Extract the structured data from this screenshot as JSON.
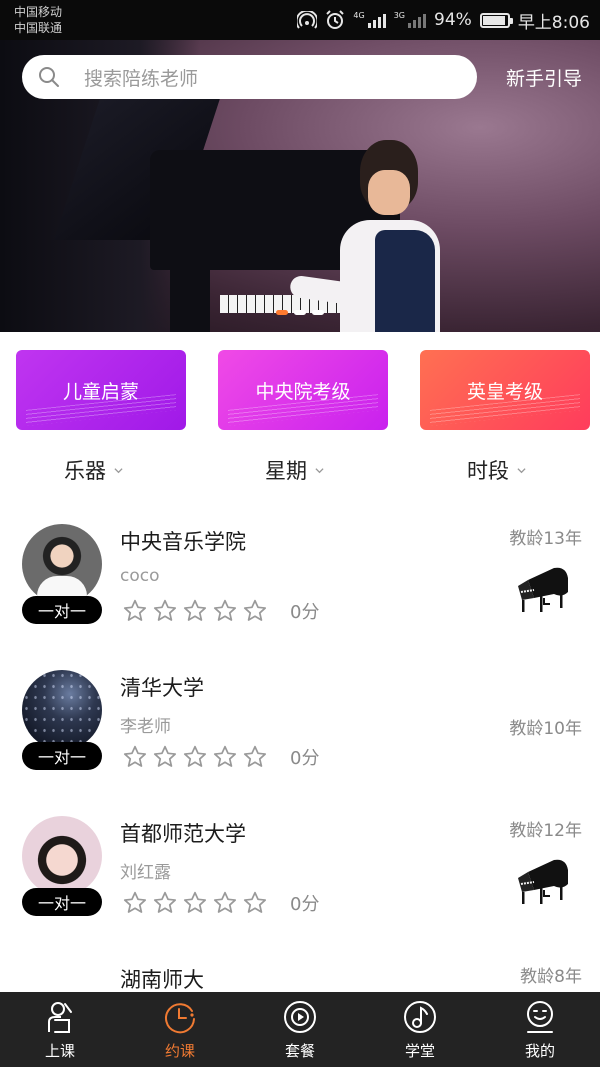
{
  "status_bar": {
    "carrier_1": "中国移动",
    "carrier_2": "中国联通",
    "net_1": "4G",
    "net_2": "3G",
    "battery": "94%",
    "battery_level": 0.94,
    "time": "早上8:06"
  },
  "search": {
    "placeholder": "搜索陪练老师",
    "guide_label": "新手引导"
  },
  "banner": {
    "slide_count": 3,
    "active_slide": 0
  },
  "categories": [
    {
      "label": "儿童启蒙"
    },
    {
      "label": "中央院考级"
    },
    {
      "label": "英皇考级"
    }
  ],
  "filters": [
    {
      "label": "乐器"
    },
    {
      "label": "星期"
    },
    {
      "label": "时段"
    }
  ],
  "teachers": [
    {
      "school": "中央音乐学院",
      "name": "coco",
      "badge": "一对一",
      "stars": 0,
      "score": "0分",
      "experience": "教龄13年",
      "piano_icon": true
    },
    {
      "school": "清华大学",
      "name": "李老师",
      "badge": "一对一",
      "stars": 0,
      "score": "0分",
      "experience": "教龄10年",
      "piano_icon": false
    },
    {
      "school": "首都师范大学",
      "name": "刘红露",
      "badge": "一对一",
      "stars": 0,
      "score": "0分",
      "experience": "教龄12年",
      "piano_icon": true
    },
    {
      "school": "湖南师大",
      "experience": "教龄8年"
    }
  ],
  "nav": [
    {
      "label": "上课",
      "icon": "lesson-icon"
    },
    {
      "label": "约课",
      "icon": "clock-icon",
      "active": true
    },
    {
      "label": "套餐",
      "icon": "disc-icon"
    },
    {
      "label": "学堂",
      "icon": "music-note-icon"
    },
    {
      "label": "我的",
      "icon": "profile-icon"
    }
  ],
  "colors": {
    "accent": "#f07a32",
    "nav_bg": "#232323",
    "card_1": "#b02cec",
    "card_2": "#e035ea",
    "card_3": "#ff5158"
  }
}
